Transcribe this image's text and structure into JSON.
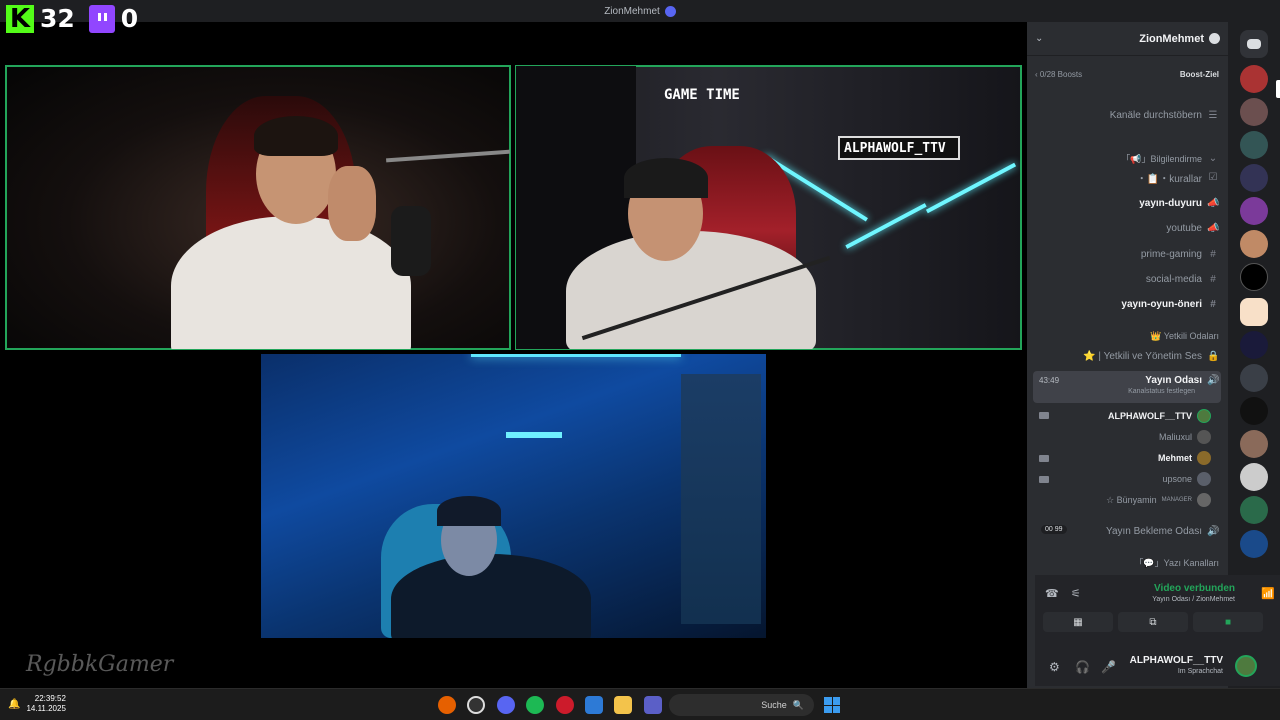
{
  "window": {
    "title": "ZionMehmet"
  },
  "overlay": {
    "kick_count": "32",
    "twitch_count": "0",
    "kick_logo": "K"
  },
  "stream": {
    "tile2_text_game": "GAME TIME",
    "tile2_text_handle": "ALPHAWOLF_TTV",
    "watermark": "RgbbkGamer"
  },
  "discord": {
    "server_name": "ZionMehmet",
    "boost_label": "Boost-Ziel",
    "boost_value": "0/28 Boosts",
    "browse_channels": "Kanäle durchstöbern",
    "channels": [
      {
        "label": "「📢」Bilgilendirme",
        "type": "category"
      },
      {
        "label": "・📋・kurallar",
        "type": "text"
      },
      {
        "label": "yayın-duyuru",
        "type": "announce",
        "bright": true
      },
      {
        "label": "youtube",
        "type": "announce"
      },
      {
        "label": "prime-gaming",
        "type": "text"
      },
      {
        "label": "social-media",
        "type": "text"
      },
      {
        "label": "yayın-oyun-öneri",
        "type": "text",
        "bright": true
      },
      {
        "label": "👑 Yetkili Odaları",
        "type": "category"
      },
      {
        "label": "⭐ | Yetkili ve Yönetim Ses",
        "type": "locked"
      }
    ],
    "active_channel": {
      "label": "Yayın Odası",
      "sub": "Kanalstatus festlegen",
      "timer": "43:49"
    },
    "members": [
      {
        "name": "ALPHAWOLF__TTV",
        "bright": true,
        "camera": true
      },
      {
        "name": "Maliuxul",
        "bright": false,
        "camera": false
      },
      {
        "name": "Mehmet",
        "bright": true,
        "camera": true
      },
      {
        "name": "upsone",
        "bright": false,
        "camera": true
      },
      {
        "name": "☆ Bünyamin",
        "badge": "MANAGER",
        "bright": false,
        "camera": false
      }
    ],
    "waiting_room": {
      "label": "Yayın Bekleme Odası",
      "counts": "00 99"
    },
    "text_category": "「💬」Yazı Kanalları",
    "voice": {
      "status": "Video verbunden",
      "sub": "Yayın Odası / ZionMehmet"
    },
    "user": {
      "name": "ALPHAWOLF__TTV",
      "status": "Im Sprachchat"
    }
  },
  "taskbar": {
    "time": "22:39:52",
    "date": "14.11.2025",
    "search_placeholder": "Suche"
  },
  "colors": {
    "speaking": "#23a55a",
    "kick": "#53fc18",
    "twitch": "#9146ff",
    "discord_blurple": "#5865f2"
  }
}
